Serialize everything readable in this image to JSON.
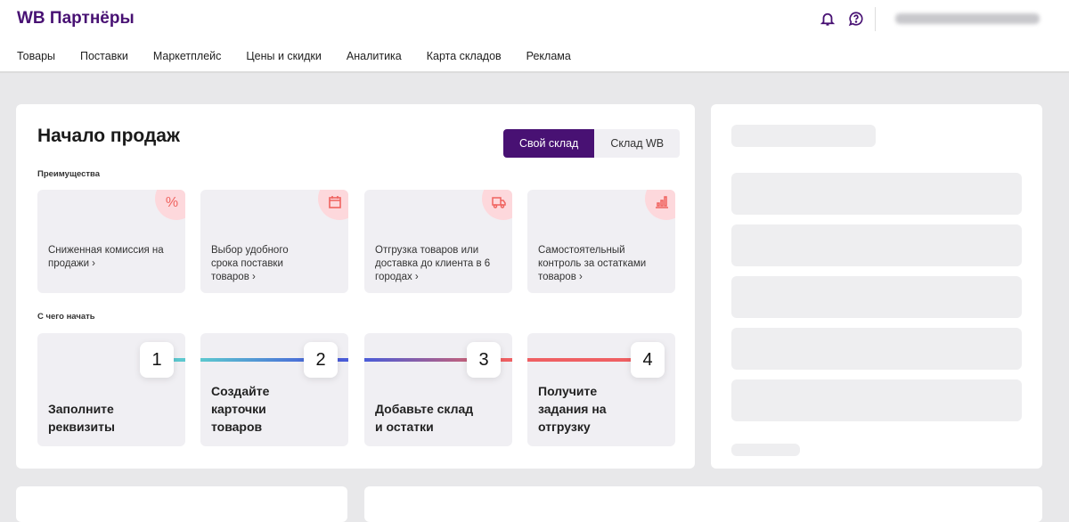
{
  "header": {
    "logo": "WB Партнёры",
    "nav": [
      "Товары",
      "Поставки",
      "Маркетплейс",
      "Цены и скидки",
      "Аналитика",
      "Карта складов",
      "Реклама"
    ]
  },
  "main": {
    "title": "Начало продаж",
    "toggle": {
      "own": "Свой склад",
      "wb": "Склад WB",
      "selected": "Свой склад"
    },
    "benefits_label": "Преимущества",
    "benefits": [
      {
        "text": "Сниженная комиссия на продажи ›",
        "icon": "percent-icon"
      },
      {
        "text": "Выбор удобного срока поставки товаров ›",
        "icon": "calendar-icon"
      },
      {
        "text": "Отгрузка товаров или доставка до клиента в 6 городах ›",
        "icon": "truck-icon"
      },
      {
        "text": "Самостоятельный контроль за остатками товаров ›",
        "icon": "chart-icon"
      }
    ],
    "start_label": "С чего начать",
    "steps": [
      {
        "num": "1",
        "text": "Заполните реквизиты"
      },
      {
        "num": "2",
        "text": "Создайте карточки товаров"
      },
      {
        "num": "3",
        "text": "Добавьте склад и остатки"
      },
      {
        "num": "4",
        "text": "Получите задания на отгрузку"
      }
    ]
  },
  "colors": {
    "brand": "#481173",
    "accent": "#f0635f"
  }
}
